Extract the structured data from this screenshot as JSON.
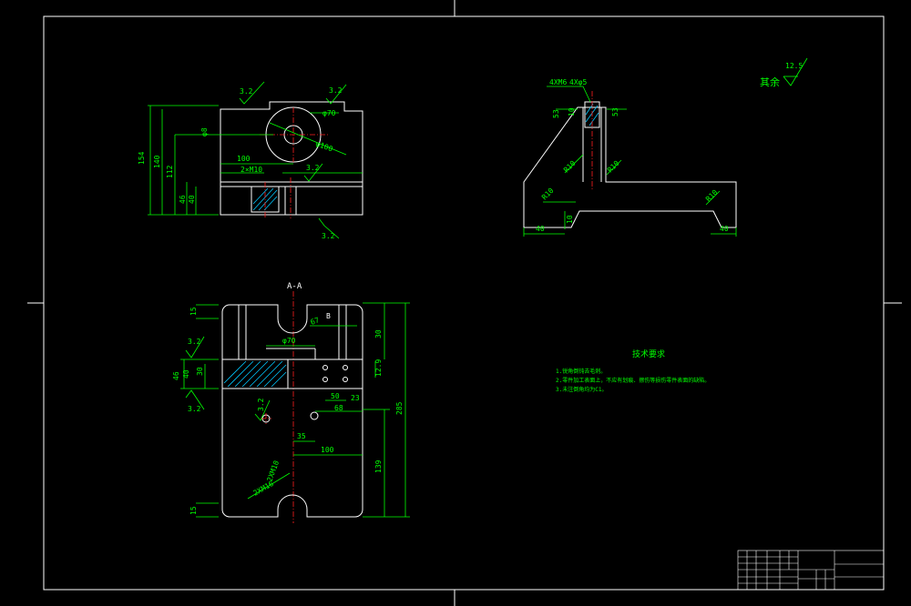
{
  "drawing": {
    "section_label": "A-A",
    "section_mark": "B",
    "roughness_rest": {
      "text": "其余",
      "value": "12.5"
    },
    "tech_requirements": {
      "title": "技术要求",
      "items": [
        "1.锐角倒钝去毛刺。",
        "2.零件加工表面上，不应有划痕、擦伤等损伤零件表面的缺陷。",
        "3.未注倒角均为C1。"
      ]
    },
    "top_view": {
      "roughness": [
        "3.2",
        "3.2",
        "3.2",
        "3.2"
      ],
      "dims": [
        "154",
        "140",
        "112",
        "46",
        "40",
        "100",
        "φ70",
        "φ100",
        "2×M10",
        "φ8"
      ]
    },
    "side_view": {
      "dims": [
        "4XM6",
        "4Xφ5",
        "53",
        "10",
        "53",
        "R10",
        "R10",
        "R10",
        "R10",
        "40",
        "10",
        "40"
      ]
    },
    "section_view": {
      "roughness": [
        "3.2",
        "3.2",
        "3.2"
      ],
      "dims": [
        "15",
        "67",
        "30",
        "φ70",
        "46",
        "40",
        "30",
        "12.9",
        "50",
        "23",
        "68",
        "285",
        "35",
        "100",
        "139",
        "15",
        "2XM10",
        "2XM16"
      ]
    }
  }
}
